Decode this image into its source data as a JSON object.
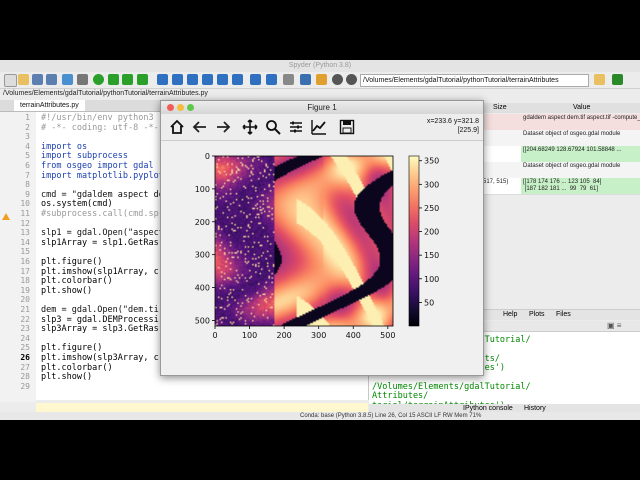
{
  "app": {
    "title": "Spyder (Python 3.8)"
  },
  "toolbar": {
    "path": "/Volumes/Elements/gdalTutorial/pythonTutorial/terrainAttributes"
  },
  "editor": {
    "file_path": "/Volumes/Elements/gdalTutorial/pythonTutorial/terrainAttributes.py",
    "tab_label": "terrainAttributes.py",
    "lines": [
      {
        "n": "1",
        "text": "#!/usr/bin/env python3"
      },
      {
        "n": "2",
        "text": "# -*- coding: utf-8 -*-"
      },
      {
        "n": "3",
        "text": ""
      },
      {
        "n": "4",
        "text": "import os"
      },
      {
        "n": "5",
        "text": "import subprocess"
      },
      {
        "n": "6",
        "text": "from osgeo import gdal"
      },
      {
        "n": "7",
        "text": "import matplotlib.pyplot"
      },
      {
        "n": "8",
        "text": ""
      },
      {
        "n": "9",
        "text": "cmd = \"gdaldem aspect de"
      },
      {
        "n": "10",
        "text": "os.system(cmd)"
      },
      {
        "n": "11",
        "text": "#subprocess.call(cmd.sp"
      },
      {
        "n": "12",
        "text": ""
      },
      {
        "n": "13",
        "text": "slp1 = gdal.Open(\"aspect"
      },
      {
        "n": "14",
        "text": "slp1Array = slp1.GetRas"
      },
      {
        "n": "15",
        "text": ""
      },
      {
        "n": "16",
        "text": "plt.figure()"
      },
      {
        "n": "17",
        "text": "plt.imshow(slp1Array, c"
      },
      {
        "n": "18",
        "text": "plt.colorbar()"
      },
      {
        "n": "19",
        "text": "plt.show()"
      },
      {
        "n": "20",
        "text": ""
      },
      {
        "n": "21",
        "text": "dem = gdal.Open(\"dem.ti"
      },
      {
        "n": "22",
        "text": "slp3 = gdal.DEMProcessi"
      },
      {
        "n": "23",
        "text": "slp3Array = slp3.GetRas"
      },
      {
        "n": "24",
        "text": ""
      },
      {
        "n": "25",
        "text": "plt.figure()"
      },
      {
        "n": "26",
        "text": "plt.imshow(slp3Array, c"
      },
      {
        "n": "27",
        "text": "plt.colorbar()"
      },
      {
        "n": "28",
        "text": "plt.show()"
      },
      {
        "n": "29",
        "text": ""
      }
    ]
  },
  "variables": {
    "size_header": "Size",
    "value_header": "Value",
    "rows": [
      {
        "size": "",
        "value": "gdaldem aspect dem.tif aspect.tif -compute_edges"
      },
      {
        "size": "",
        "value": "Dataset object of osgeo.gdal module"
      },
      {
        "size": "",
        "value": "[[204.68249 128.67924 101.58848 ..."
      },
      {
        "size": "",
        "value": "Dataset object of osgeo.gdal module"
      },
      {
        "size": "(517, 515)",
        "value": "[[178 174 176 ... 123 105  84]\n [187 182 181 ...  99  79  61]"
      }
    ]
  },
  "pane_tabs": [
    "Help",
    "Plots",
    "Files"
  ],
  "console": {
    "lines": [
      "/Volumes/Elements/gdalTutorial/",
      "Attributes/",
      " wdir='/Volumes/Elements/",
      "torial/terrainAttributes')",
      "",
      "/Volumes/Elements/gdalTutorial/",
      "Attributes/",
      "torial/terrainAttributes')",
      "  wdir='/Volumes/Elements/",
      "torial/terrainAttributes')",
      "...50...60...70...80...90...100 -",
      "Done.",
      "",
      "In [16]:"
    ],
    "tabs": [
      "IPython console",
      "History"
    ]
  },
  "status": "Conda: base (Python 3.8.5)   Line 26, Col 15   ASCII   LF   RW   Mem 71%",
  "figure": {
    "title": "Figure 1",
    "coord_line1": "x=233.6 y=321.8",
    "coord_line2": "[225.9]",
    "toolbar_icons": [
      "home-icon",
      "back-icon",
      "forward-icon",
      "pan-icon",
      "zoom-icon",
      "configure-icon",
      "edit-axis-icon",
      "save-icon"
    ]
  },
  "chart_data": {
    "type": "heatmap",
    "title": "",
    "xlabel": "",
    "ylabel": "",
    "x_ticks": [
      "0",
      "100",
      "200",
      "300",
      "400",
      "500"
    ],
    "y_ticks": [
      "0",
      "100",
      "200",
      "300",
      "400",
      "500"
    ],
    "xlim": [
      0,
      515
    ],
    "ylim": [
      517,
      0
    ],
    "colorbar_ticks": [
      "350",
      "300",
      "250",
      "200",
      "150",
      "100",
      "50"
    ],
    "colorbar_range": [
      0,
      360
    ],
    "colormap": "magma"
  }
}
